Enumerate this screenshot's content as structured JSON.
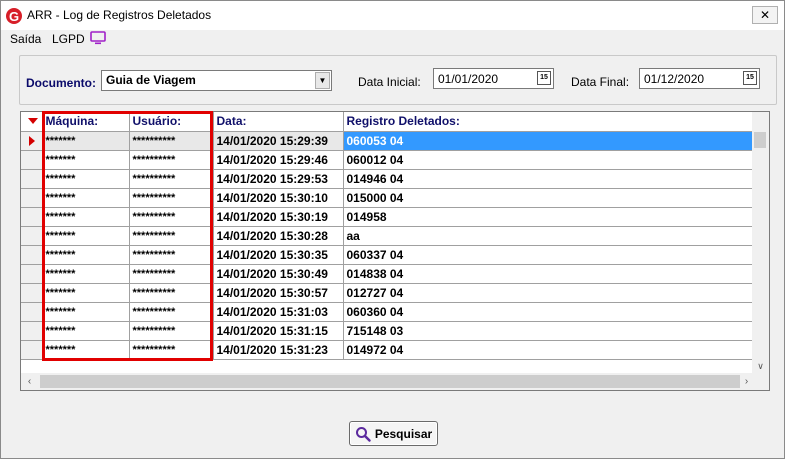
{
  "window": {
    "title": "ARR - Log de Registros Deletados",
    "app_icon_letter": "G",
    "close_glyph": "✕"
  },
  "menu": {
    "items": [
      {
        "label": "Saída"
      },
      {
        "label": "LGPD"
      }
    ],
    "monitor_icon": "monitor-icon"
  },
  "filters": {
    "documento_label": "Documento:",
    "documento_value": "Guia de Viagem",
    "data_inicial_label": "Data Inicial:",
    "data_inicial_value": "01/01/2020",
    "data_final_label": "Data Final:",
    "data_final_value": "01/12/2020",
    "calendar_glyph": "15"
  },
  "grid": {
    "columns": [
      "Máquina:",
      "Usuário:",
      "Data:",
      "Registro Deletados:"
    ],
    "rows": [
      {
        "maquina": "*******",
        "usuario": "**********",
        "data": "14/01/2020 15:29:39",
        "registro": "060053 04"
      },
      {
        "maquina": "*******",
        "usuario": "**********",
        "data": "14/01/2020 15:29:46",
        "registro": "060012 04"
      },
      {
        "maquina": "*******",
        "usuario": "**********",
        "data": "14/01/2020 15:29:53",
        "registro": "014946 04"
      },
      {
        "maquina": "*******",
        "usuario": "**********",
        "data": "14/01/2020 15:30:10",
        "registro": "015000 04"
      },
      {
        "maquina": "*******",
        "usuario": "**********",
        "data": "14/01/2020 15:30:19",
        "registro": "014958"
      },
      {
        "maquina": "*******",
        "usuario": "**********",
        "data": "14/01/2020 15:30:28",
        "registro": "aa"
      },
      {
        "maquina": "*******",
        "usuario": "**********",
        "data": "14/01/2020 15:30:35",
        "registro": "060337 04"
      },
      {
        "maquina": "*******",
        "usuario": "**********",
        "data": "14/01/2020 15:30:49",
        "registro": "014838 04"
      },
      {
        "maquina": "*******",
        "usuario": "**********",
        "data": "14/01/2020 15:30:57",
        "registro": "012727 04"
      },
      {
        "maquina": "*******",
        "usuario": "**********",
        "data": "14/01/2020 15:31:03",
        "registro": "060360 04"
      },
      {
        "maquina": "*******",
        "usuario": "**********",
        "data": "14/01/2020 15:31:15",
        "registro": "715148 03"
      },
      {
        "maquina": "*******",
        "usuario": "**********",
        "data": "14/01/2020 15:31:23",
        "registro": "014972 04"
      }
    ],
    "selected_row": 0
  },
  "actions": {
    "search_label": "Pesquisar"
  },
  "colors": {
    "selection": "#3399ff",
    "highlight_box": "#e10000",
    "header_text": "#10106a"
  }
}
